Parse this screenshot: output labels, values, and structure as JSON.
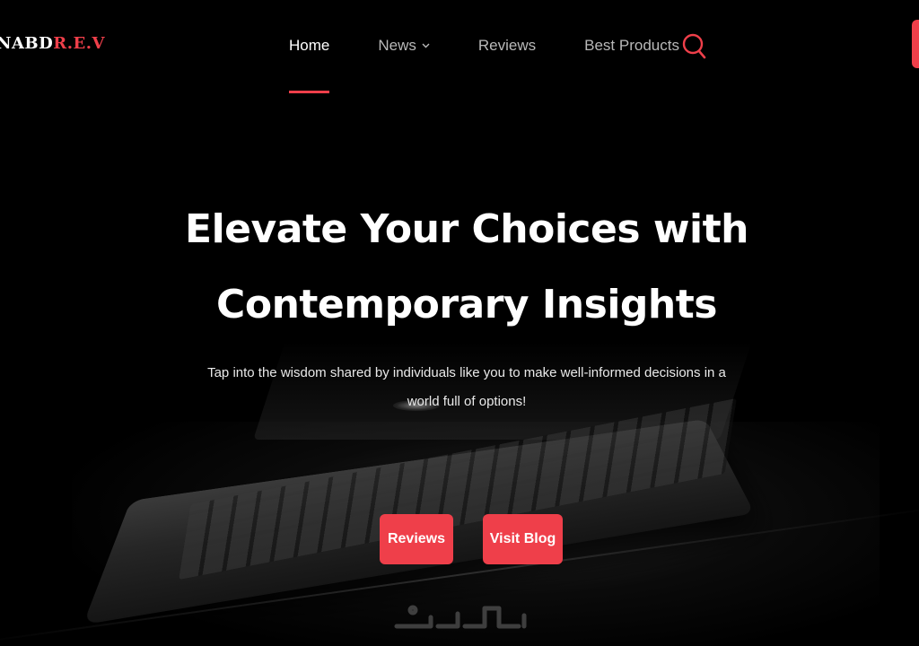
{
  "brand": {
    "logo_part1": "NABD",
    "logo_part2": "R.E.V"
  },
  "nav": {
    "items": [
      {
        "label": "Home",
        "active": true
      },
      {
        "label": "News",
        "has_dropdown": true
      },
      {
        "label": "Reviews"
      },
      {
        "label": "Best Products"
      }
    ],
    "search_icon": "search-icon"
  },
  "hero": {
    "title_line1": "Elevate Your Choices with",
    "title_line2": "Contemporary Insights",
    "subtitle": "Tap into the wisdom shared by individuals like you to make well-informed decisions in a world full of options!",
    "buttons": {
      "reviews_label": "Reviews",
      "blog_label": "Visit Blog"
    }
  },
  "colors": {
    "accent": "#ef3f4a",
    "background": "#000000",
    "text": "#ffffff",
    "nav_text": "#b9b9b9"
  }
}
